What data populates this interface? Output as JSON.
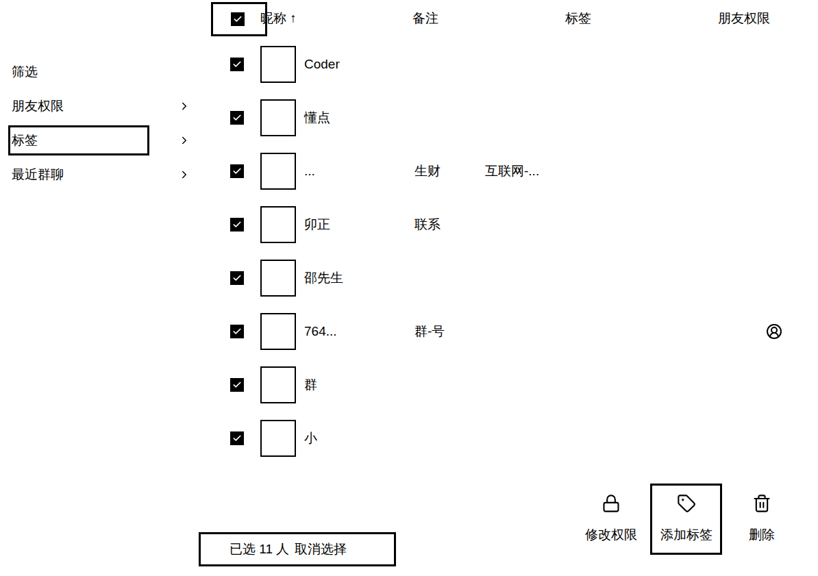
{
  "sidebar": {
    "items": [
      {
        "label": "筛选",
        "has_arrow": false,
        "highlighted": false
      },
      {
        "label": "朋友权限",
        "has_arrow": true,
        "highlighted": false
      },
      {
        "label": "标签",
        "has_arrow": true,
        "highlighted": true
      },
      {
        "label": "最近群聊",
        "has_arrow": true,
        "highlighted": false
      }
    ]
  },
  "table": {
    "select_all": {
      "checked": true,
      "highlighted": true
    },
    "columns": [
      "昵称 ↑",
      "备注",
      "标签",
      "朋友权限"
    ],
    "rows": [
      {
        "name": "Coder",
        "remark": "",
        "tag": "",
        "checked": true,
        "permission_icon": false
      },
      {
        "name": "懂点",
        "remark": "",
        "tag": "",
        "checked": true,
        "permission_icon": false
      },
      {
        "name": "...",
        "remark": "生财",
        "tag": "互联网-...",
        "checked": true,
        "permission_icon": false
      },
      {
        "name": "卯正",
        "remark": "联系",
        "tag": "",
        "checked": true,
        "permission_icon": false
      },
      {
        "name": "邵先生",
        "remark": "",
        "tag": "",
        "checked": true,
        "permission_icon": false
      },
      {
        "name": "764...",
        "remark": "群-号",
        "tag": "",
        "checked": true,
        "permission_icon": true
      },
      {
        "name": "群",
        "remark": "",
        "tag": "",
        "checked": true,
        "permission_icon": false
      },
      {
        "name": "小",
        "remark": "",
        "tag": "",
        "checked": true,
        "permission_icon": false
      }
    ]
  },
  "status_bar": {
    "count": "已选 11 人",
    "cancel": "取消选择",
    "highlighted": true
  },
  "buttons": [
    {
      "label": "修改权限",
      "kind": "lock",
      "highlighted": false
    },
    {
      "label": "添加标签",
      "kind": "tag",
      "highlighted": true
    },
    {
      "label": "删除",
      "kind": "trash",
      "highlighted": false
    }
  ]
}
